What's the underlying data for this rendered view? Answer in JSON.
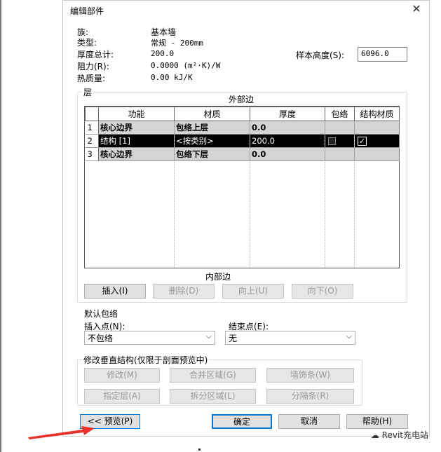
{
  "dialog": {
    "title": "编辑部件",
    "close_glyph": "✕"
  },
  "properties": {
    "family_label": "族:",
    "family_value": "基本墙",
    "type_label": "类型:",
    "type_value": "常规 - 200mm",
    "thickness_label": "厚度总计:",
    "thickness_value": "200.0",
    "resistance_label": "阻力(R):",
    "resistance_value": "0.0000 (m²·K)/W",
    "thermal_label": "热质量:",
    "thermal_value": "0.00 kJ/K"
  },
  "sample_height": {
    "label": "样本高度(S):",
    "value": "6096.0"
  },
  "layers": {
    "legend": "层",
    "exterior_label": "外部边",
    "interior_label": "内部边",
    "columns": [
      "功能",
      "材质",
      "厚度",
      "包络",
      "结构材质"
    ],
    "rows": [
      {
        "num": "1",
        "function": "核心边界",
        "material": "包络上层",
        "thickness": "0.0",
        "style": "gray"
      },
      {
        "num": "2",
        "function": "结构 [1]",
        "material": "<按类别>",
        "thickness": "200.0",
        "style": "sel",
        "wrap_checked": false,
        "structural_checked": true
      },
      {
        "num": "3",
        "function": "核心边界",
        "material": "包络下层",
        "thickness": "0.0",
        "style": "gray"
      }
    ],
    "buttons": {
      "insert": "插入(I)",
      "delete": "删除(D)",
      "up": "向上(U)",
      "down": "向下(O)"
    }
  },
  "default_wrap": {
    "legend": "默认包络",
    "insert_label": "插入点(N):",
    "insert_value": "不包络",
    "end_label": "结束点(E):",
    "end_value": "无"
  },
  "modify_structure": {
    "legend": "修改垂直结构(仅限于剖面预览中)",
    "buttons": {
      "modify": "修改(M)",
      "merge": "合并区域(G)",
      "sweep": "墙饰条(W)",
      "assign": "指定层(A)",
      "split": "拆分区域(L)",
      "reveal": "分隔条(R)"
    }
  },
  "footer": {
    "preview": "<< 预览(P)",
    "ok": "确定",
    "cancel": "取消",
    "help": "帮助(H)"
  },
  "watermark": "Revit充电站",
  "colors": {
    "arrow": "#e8312a",
    "focus": "#0078d7"
  }
}
